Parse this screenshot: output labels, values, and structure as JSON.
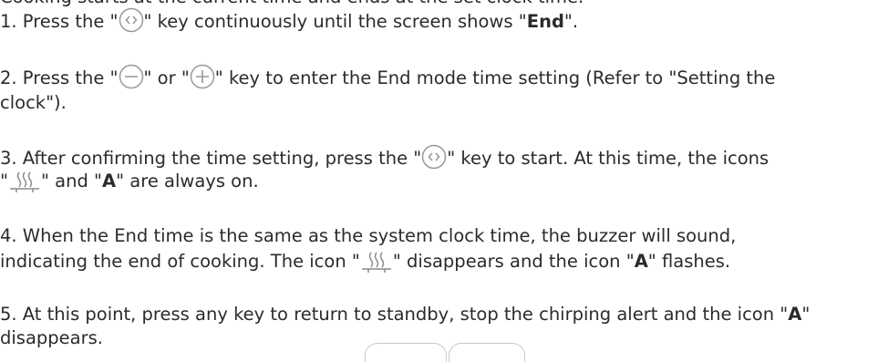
{
  "intro_partial": "Cooking starts at the current time and ends at the set clock time.",
  "icons": {
    "arrows_key": "left-right-arrows-circle-icon",
    "minus_key": "minus-circle-icon",
    "plus_key": "plus-circle-icon",
    "heating": "heating-waves-icon"
  },
  "steps": [
    {
      "a": "1. Press the \"",
      "b": "\" key continuously until the screen shows \"",
      "c": "End",
      "d": "\"."
    },
    {
      "a": "2. Press the \"",
      "b": "\" or \"",
      "c": "\" key to enter the End mode time setting (Refer to \"Setting the",
      "d": "clock\")."
    },
    {
      "a": "3. After confirming the time setting, press the \"",
      "b": "\" key to start. At this time, the icons",
      "c": "\"",
      "d": "\" and \"",
      "e": "A",
      "f": "\" are always on."
    },
    {
      "a": "4. When the End time is the same as the system clock time, the buzzer will sound,",
      "b": "indicating the end of cooking. The icon \"",
      "c": "\" disappears and the icon \"",
      "d": "A",
      "e": "\" flashes."
    },
    {
      "a": "5. At this point, press any key to return to standby, stop the chirping alert and the icon \"",
      "b": "A",
      "c": "\"",
      "d": "disappears."
    }
  ]
}
